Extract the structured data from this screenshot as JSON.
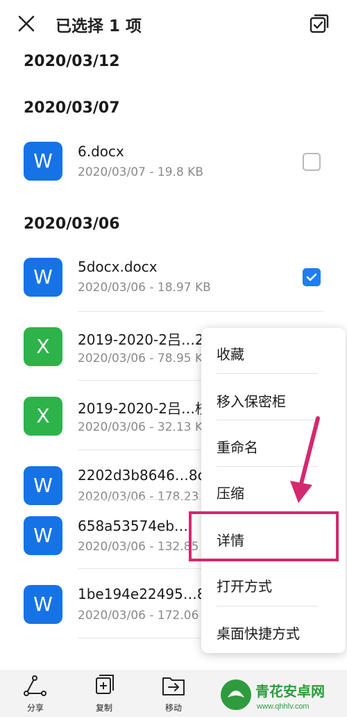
{
  "header": {
    "title": "已选择 1 项",
    "close_icon": "close-icon",
    "select_all_icon": "select-all-icon"
  },
  "groups": [
    {
      "date": "2020/03/12",
      "files": []
    },
    {
      "date": "2020/03/07",
      "files": [
        {
          "type": "W",
          "name": "6.docx",
          "meta": "2020/03/07 - 19.8 KB",
          "checked": false
        }
      ]
    },
    {
      "date": "2020/03/06",
      "files": [
        {
          "type": "W",
          "name": "5docx.docx",
          "meta": "2020/03/06 - 18.97 KB",
          "checked": true
        },
        {
          "type": "X",
          "name": "2019-2020-2吕…21",
          "meta": "2020/03/06 - 78.95 KB"
        },
        {
          "type": "X",
          "name": "2019-2020-2吕…校",
          "meta": "2020/03/06 - 32.13 KB"
        },
        {
          "type": "W",
          "name": "2202d3b8646…8c",
          "meta": "2020/03/06 - 178.23"
        },
        {
          "type": "W",
          "name": "658a53574eb…",
          "meta": "2020/03/06 - 132.85"
        },
        {
          "type": "W",
          "name": "1be194e22495…8",
          "meta": "2020/03/06 - 172.06"
        }
      ]
    }
  ],
  "context_menu": [
    "收藏",
    "移入保密柜",
    "重命名",
    "压缩",
    "详情",
    "打开方式",
    "桌面快捷方式"
  ],
  "bottom_bar": [
    {
      "label": "分享",
      "icon": "share-icon"
    },
    {
      "label": "复制",
      "icon": "copy-icon"
    },
    {
      "label": "移动",
      "icon": "move-icon"
    }
  ],
  "watermark": {
    "title": "青花安卓网",
    "url": "www.qhhlv.com"
  },
  "colors": {
    "accent": "#1e7ef0",
    "word": "#1673e6",
    "excel": "#2db34a",
    "highlight": "#d4296e"
  }
}
